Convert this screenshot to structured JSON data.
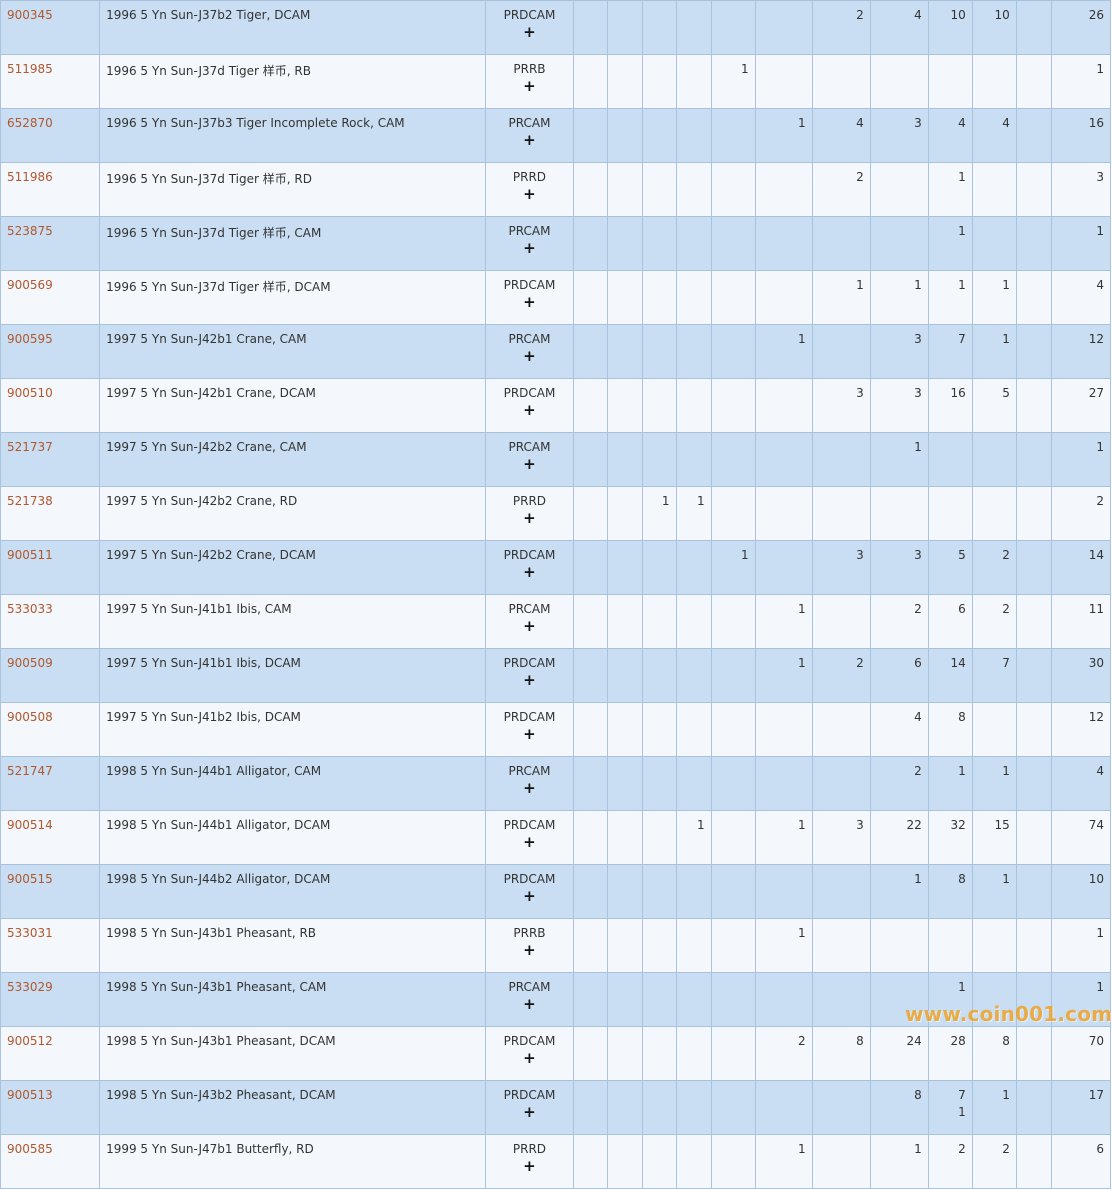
{
  "rows": [
    {
      "id": "900345",
      "desc": "1996 5 Yn Sun-J37b2 Tiger, DCAM",
      "designation": "PRDCAM",
      "counts": [
        "",
        "",
        "",
        "",
        "",
        "",
        "2",
        "4",
        "10",
        "10",
        "",
        "26"
      ]
    },
    {
      "id": "511985",
      "desc": "1996 5 Yn Sun-J37d Tiger 样币, RB",
      "designation": "PRRB",
      "counts": [
        "",
        "",
        "",
        "",
        "1",
        "",
        "",
        "",
        "",
        "",
        "",
        "1"
      ]
    },
    {
      "id": "652870",
      "desc": "1996 5 Yn Sun-J37b3 Tiger Incomplete Rock, CAM",
      "designation": "PRCAM",
      "counts": [
        "",
        "",
        "",
        "",
        "",
        "1",
        "4",
        "3",
        "4",
        "4",
        "",
        "16"
      ]
    },
    {
      "id": "511986",
      "desc": "1996 5 Yn Sun-J37d Tiger 样币, RD",
      "designation": "PRRD",
      "counts": [
        "",
        "",
        "",
        "",
        "",
        "",
        "2",
        "",
        "1",
        "",
        "",
        "3"
      ]
    },
    {
      "id": "523875",
      "desc": "1996 5 Yn Sun-J37d Tiger 样币, CAM",
      "designation": "PRCAM",
      "counts": [
        "",
        "",
        "",
        "",
        "",
        "",
        "",
        "",
        "1",
        "",
        "",
        "1"
      ]
    },
    {
      "id": "900569",
      "desc": "1996 5 Yn Sun-J37d Tiger 样币, DCAM",
      "designation": "PRDCAM",
      "counts": [
        "",
        "",
        "",
        "",
        "",
        "",
        "1",
        "1",
        "1",
        "1",
        "",
        "4"
      ]
    },
    {
      "id": "900595",
      "desc": "1997 5 Yn Sun-J42b1 Crane, CAM",
      "designation": "PRCAM",
      "counts": [
        "",
        "",
        "",
        "",
        "",
        "1",
        "",
        "3",
        "7",
        "1",
        "",
        "12"
      ]
    },
    {
      "id": "900510",
      "desc": "1997 5 Yn Sun-J42b1 Crane, DCAM",
      "designation": "PRDCAM",
      "counts": [
        "",
        "",
        "",
        "",
        "",
        "",
        "3",
        "3",
        "16",
        "5",
        "",
        "27"
      ]
    },
    {
      "id": "521737",
      "desc": "1997 5 Yn Sun-J42b2 Crane, CAM",
      "designation": "PRCAM",
      "counts": [
        "",
        "",
        "",
        "",
        "",
        "",
        "",
        "1",
        "",
        "",
        "",
        "1"
      ]
    },
    {
      "id": "521738",
      "desc": "1997 5 Yn Sun-J42b2 Crane, RD",
      "designation": "PRRD",
      "counts": [
        "",
        "",
        "1",
        "1",
        "",
        "",
        "",
        "",
        "",
        "",
        "",
        "2"
      ]
    },
    {
      "id": "900511",
      "desc": "1997 5 Yn Sun-J42b2 Crane, DCAM",
      "designation": "PRDCAM",
      "counts": [
        "",
        "",
        "",
        "",
        "1",
        "",
        "3",
        "3",
        "5",
        "2",
        "",
        "14"
      ]
    },
    {
      "id": "533033",
      "desc": "1997 5 Yn Sun-J41b1 Ibis, CAM",
      "designation": "PRCAM",
      "counts": [
        "",
        "",
        "",
        "",
        "",
        "1",
        "",
        "2",
        "6",
        "2",
        "",
        "11"
      ]
    },
    {
      "id": "900509",
      "desc": "1997 5 Yn Sun-J41b1 Ibis, DCAM",
      "designation": "PRDCAM",
      "counts": [
        "",
        "",
        "",
        "",
        "",
        "1",
        "2",
        "6",
        "14",
        "7",
        "",
        "30"
      ]
    },
    {
      "id": "900508",
      "desc": "1997 5 Yn Sun-J41b2 Ibis, DCAM",
      "designation": "PRDCAM",
      "counts": [
        "",
        "",
        "",
        "",
        "",
        "",
        "",
        "4",
        "8",
        "",
        "",
        "12"
      ]
    },
    {
      "id": "521747",
      "desc": "1998 5 Yn Sun-J44b1 Alligator, CAM",
      "designation": "PRCAM",
      "counts": [
        "",
        "",
        "",
        "",
        "",
        "",
        "",
        "2",
        "1",
        "1",
        "",
        "4"
      ]
    },
    {
      "id": "900514",
      "desc": "1998 5 Yn Sun-J44b1 Alligator, DCAM",
      "designation": "PRDCAM",
      "counts": [
        "",
        "",
        "",
        "1",
        "",
        "1",
        "3",
        "22",
        "32",
        "15",
        "",
        "74"
      ]
    },
    {
      "id": "900515",
      "desc": "1998 5 Yn Sun-J44b2 Alligator, DCAM",
      "designation": "PRDCAM",
      "counts": [
        "",
        "",
        "",
        "",
        "",
        "",
        "",
        "1",
        "8",
        "1",
        "",
        "10"
      ]
    },
    {
      "id": "533031",
      "desc": "1998 5 Yn Sun-J43b1 Pheasant, RB",
      "designation": "PRRB",
      "counts": [
        "",
        "",
        "",
        "",
        "",
        "1",
        "",
        "",
        "",
        "",
        "",
        "1"
      ]
    },
    {
      "id": "533029",
      "desc": "1998 5 Yn Sun-J43b1 Pheasant, CAM",
      "designation": "PRCAM",
      "counts": [
        "",
        "",
        "",
        "",
        "",
        "",
        "",
        "",
        "1",
        "",
        "",
        "1"
      ]
    },
    {
      "id": "900512",
      "desc": "1998 5 Yn Sun-J43b1 Pheasant, DCAM",
      "designation": "PRDCAM",
      "counts": [
        "",
        "",
        "",
        "",
        "",
        "2",
        "8",
        "24",
        "28",
        "8",
        "",
        "70"
      ]
    },
    {
      "id": "900513",
      "desc": "1998 5 Yn Sun-J43b2 Pheasant, DCAM",
      "designation": "PRDCAM",
      "counts": [
        "",
        "",
        "",
        "",
        "",
        "",
        "",
        "8",
        "7",
        "1",
        "",
        "17"
      ],
      "subcounts": [
        "",
        "",
        "",
        "",
        "",
        "",
        "",
        "",
        "1",
        "",
        "",
        ""
      ]
    },
    {
      "id": "900585",
      "desc": "1999 5 Yn Sun-J47b1 Butterfly, RD",
      "designation": "PRRD",
      "counts": [
        "",
        "",
        "",
        "",
        "",
        "1",
        "",
        "1",
        "2",
        "2",
        "",
        "6"
      ]
    }
  ],
  "plus_glyph": "+",
  "watermark": "www.coin001.com",
  "colors": {
    "row_blue": "#c9def2",
    "row_white": "#f4f8fc",
    "border": "#a9c3dd",
    "link": "#b0582f",
    "watermark": "#f0a020"
  }
}
